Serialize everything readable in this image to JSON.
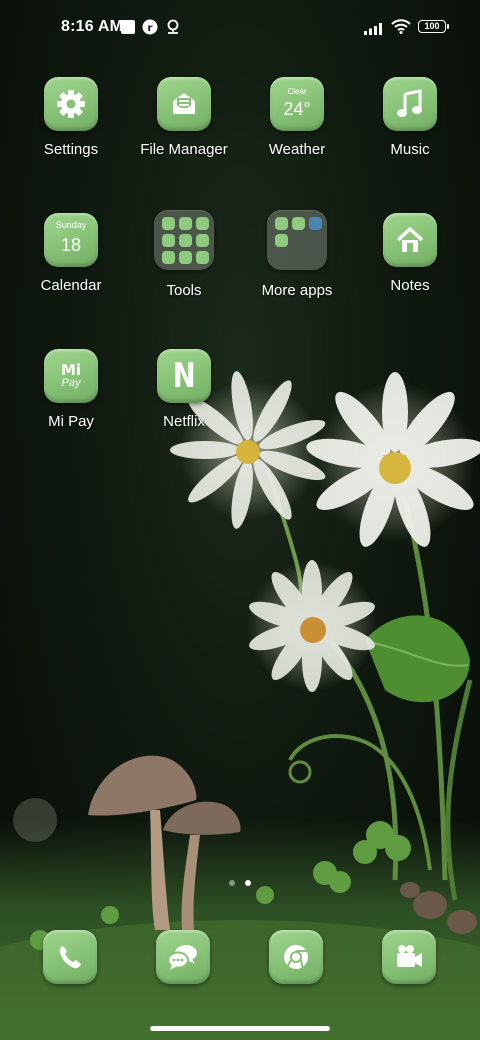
{
  "status_bar": {
    "time": "8:16 AM",
    "battery": "100"
  },
  "apps": [
    {
      "label": "Settings",
      "icon": "gear-icon"
    },
    {
      "label": "File Manager",
      "icon": "envelope-tray-icon"
    },
    {
      "label": "Weather",
      "icon": "weather-icon",
      "condition": "Clear",
      "temperature": "24°"
    },
    {
      "label": "Music",
      "icon": "music-note-icon"
    },
    {
      "label": "Calendar",
      "icon": "calendar-icon",
      "day": "Sunday",
      "date": "18"
    },
    {
      "label": "Tools",
      "icon": "folder-icon"
    },
    {
      "label": "More apps",
      "icon": "folder-icon"
    },
    {
      "label": "Notes",
      "icon": "house-icon"
    },
    {
      "label": "Mi Pay",
      "icon": "mi-pay-icon",
      "brand_top": "Mi",
      "brand_bottom": "Pay"
    },
    {
      "label": "Netflix",
      "icon": "netflix-icon",
      "letter": "N"
    }
  ],
  "dock": [
    {
      "name": "phone",
      "icon": "phone-icon"
    },
    {
      "name": "messages",
      "icon": "chat-bubbles-icon"
    },
    {
      "name": "browser",
      "icon": "chrome-icon"
    },
    {
      "name": "camera",
      "icon": "video-camera-icon"
    }
  ],
  "pager": {
    "pages": 2,
    "current": 2
  },
  "colors": {
    "tile": "#8fcb7e",
    "tile_dark": "#72ad63",
    "background": "#0b120b"
  }
}
